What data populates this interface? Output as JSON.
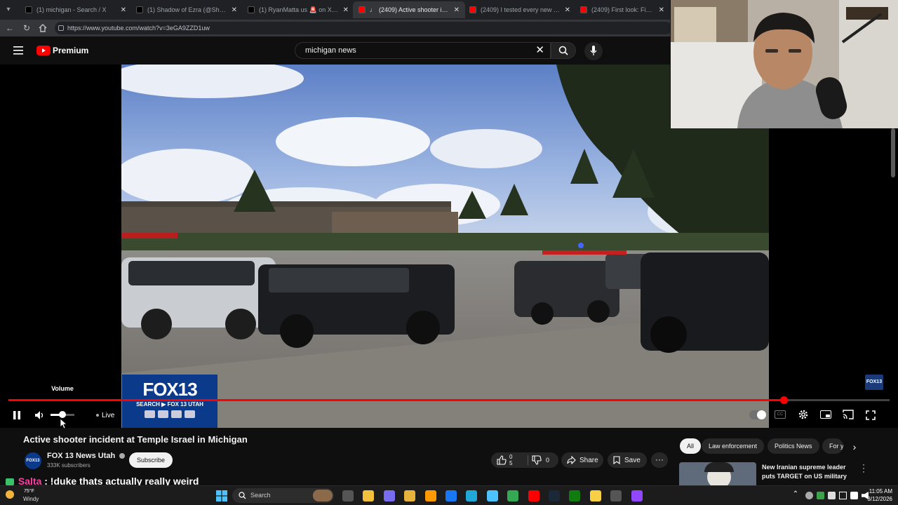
{
  "browser": {
    "tabs": [
      {
        "title": "(1) michigan - Search / X",
        "favicon_color": "#000000",
        "active": false
      },
      {
        "title": "(1) Shadow of Ezra (@Shadowofl...",
        "favicon_color": "#000000",
        "active": false
      },
      {
        "title": "(1) RyanMatta us 🚨 on X: \"Harris...",
        "favicon_color": "#000000",
        "active": false
      },
      {
        "title": "(2409) Active shooter incident...",
        "favicon_color": "#ff0000",
        "active": true
      },
      {
        "title": "(2409) I tested every new Apple F...",
        "favicon_color": "#ff0000",
        "active": false
      },
      {
        "title": "(2409) First look: Figure 03 hum...",
        "favicon_color": "#ff0000",
        "active": false
      }
    ],
    "url": "https://www.youtube.com/watch?v=3eGA9ZZD1uw"
  },
  "youtube": {
    "logo_text": "Premium",
    "search_value": "michigan news"
  },
  "player": {
    "overlay_logo_main": "FOX13",
    "overlay_logo_sub": "SEARCH ▶ FOX 13 UTAH",
    "volume_tooltip": "Volume",
    "live_label": "Live",
    "corner_bug": "FOX13",
    "progress_fraction": 0.88
  },
  "video": {
    "title": "Active shooter incident at Temple Israel in Michigan",
    "channel_name": "FOX 13 News Utah",
    "channel_avatar_text": "FOX13",
    "subscribers": "333K subscribers",
    "subscribe_label": "Subscribe",
    "likes": "0",
    "likes_sub": "5",
    "dislikes": "0",
    "share_label": "Share",
    "save_label": "Save"
  },
  "chips": [
    "All",
    "Law enforcement",
    "Politics News",
    "For y"
  ],
  "suggested": {
    "title_line1": "New Iranian supreme leader",
    "title_line2": "puts TARGET on US military ..."
  },
  "chat": {
    "user": "Salta",
    "message": ": !duke thats actually really weird",
    "user_color": "#ff3fa4"
  },
  "taskbar": {
    "weather_temp": "75°F",
    "weather_desc": "Windy",
    "search_label": "Search",
    "time": "11:05 AM",
    "date": "3/12/2026"
  }
}
